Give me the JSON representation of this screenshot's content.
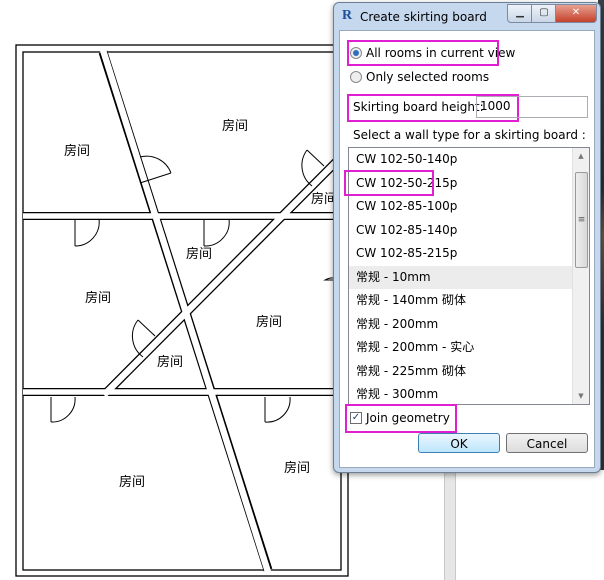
{
  "plan": {
    "room_label": "房间",
    "rooms": [
      "房间",
      "房间",
      "房间",
      "房间",
      "房间",
      "房间",
      "房间",
      "房间",
      "房间"
    ]
  },
  "dialog": {
    "app_icon": "R",
    "title": "Create skirting board",
    "controls": {
      "minimize": "minimize-icon",
      "maximize": "maximize-icon",
      "close": "close-icon"
    },
    "options": {
      "all_rooms": "All rooms in current view",
      "selected_rooms": "Only selected rooms",
      "selected": "all_rooms"
    },
    "height_label": "Skirting board height:",
    "height_value": "1000",
    "wall_type_label": "Select a wall type for a skirting board :",
    "wall_types": [
      "CW 102-50-140p",
      "CW 102-50-215p",
      "CW 102-85-100p",
      "CW 102-85-140p",
      "CW 102-85-215p",
      "常规 - 10mm",
      "常规 - 140mm 砌体",
      "常规 - 200mm",
      "常规 - 200mm - 实心",
      "常规 - 225mm 砌体",
      "常规 - 300mm"
    ],
    "selected_wall_type": "常规 - 10mm",
    "join_geometry_label": "Join geometry",
    "join_geometry_checked": true,
    "ok_label": "OK",
    "cancel_label": "Cancel",
    "highlight_color": "#e020d0"
  }
}
